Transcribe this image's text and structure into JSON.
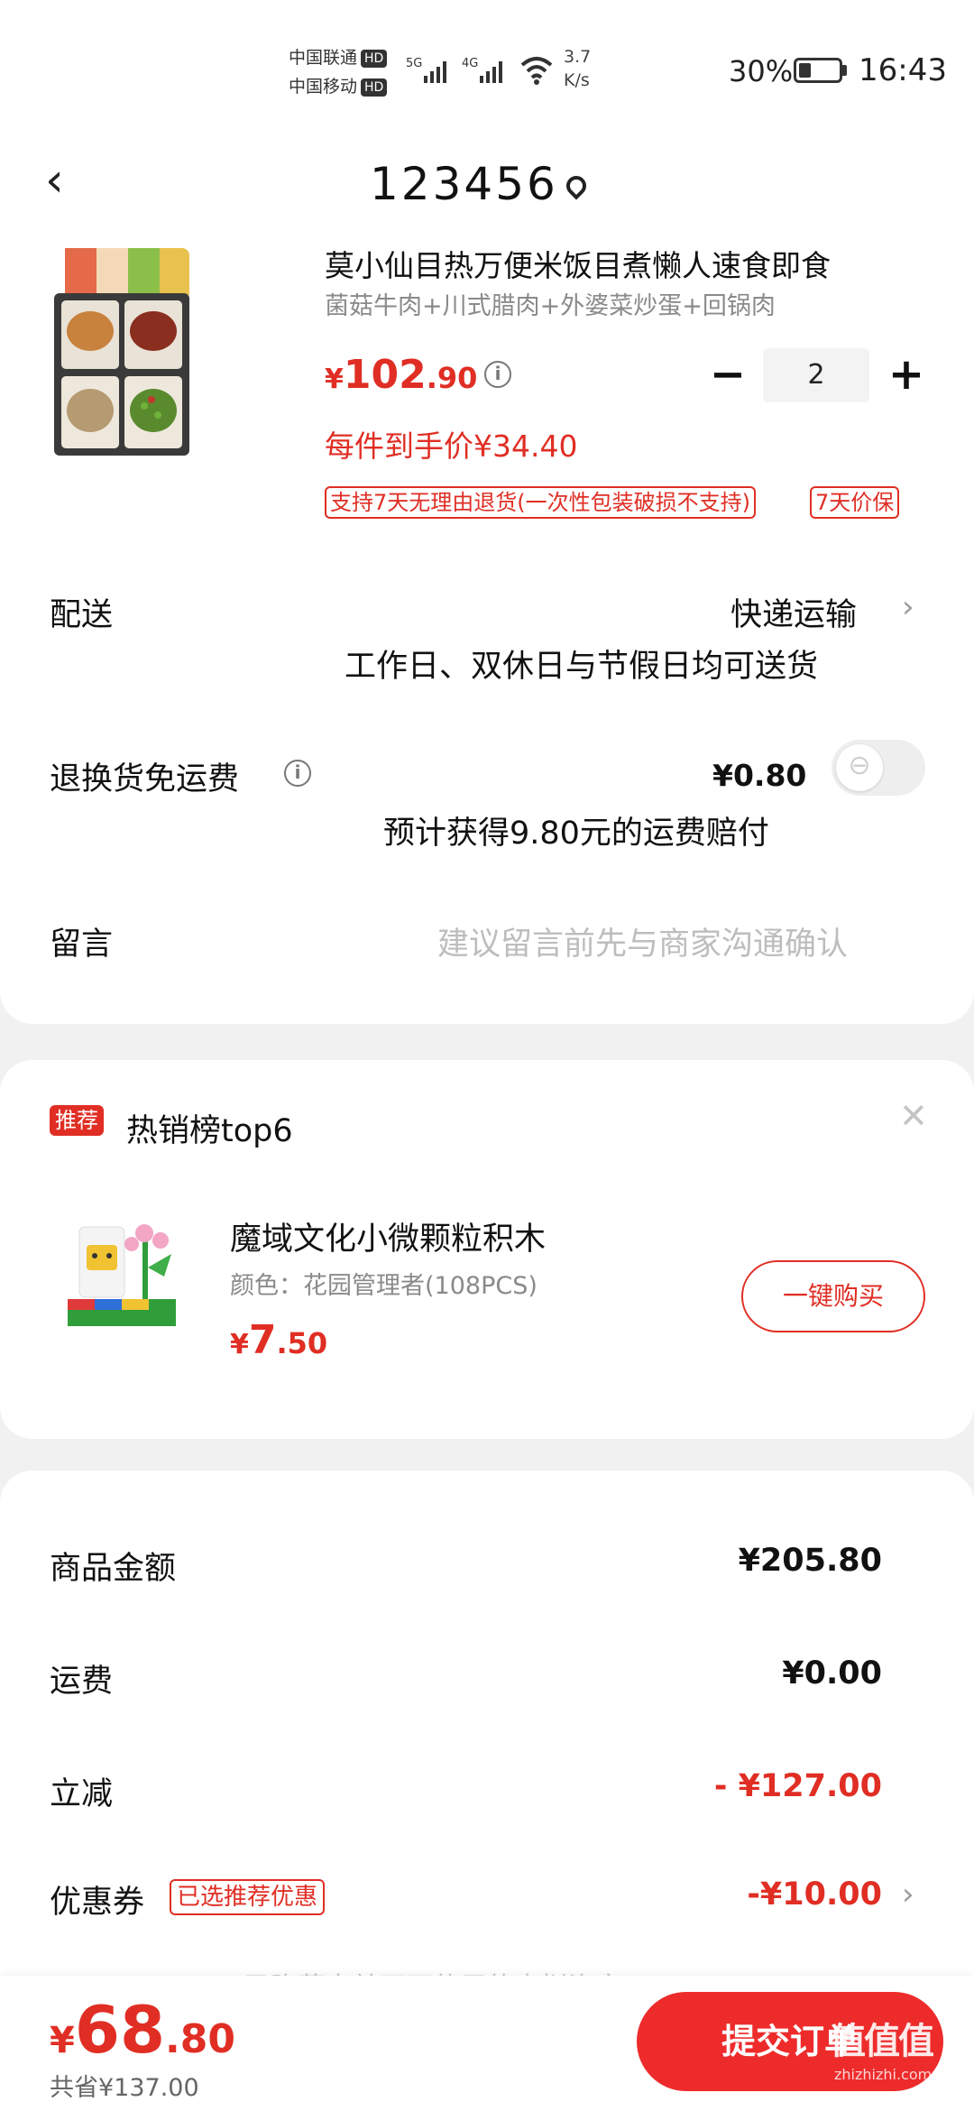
{
  "status_bar": {
    "carrier1": "中国联通",
    "carrier2": "中国移动",
    "hd": "HD",
    "sig1": "5G",
    "sig2": "4G",
    "speed_value": "3.7",
    "speed_unit": "K/s",
    "battery": "30%",
    "battery_level": 0.3,
    "time": "16:43"
  },
  "header": {
    "address": "123456"
  },
  "product": {
    "title": "莫小仙目热万便米饭目煮懒人速食即食",
    "spec": "菌菇牛肉+川式腊肉+外婆菜炒蛋+回锅肉",
    "price_symbol": "¥",
    "price_int": "102",
    "price_dec": ".90",
    "quantity": "2",
    "per_price": "每件到手价¥34.40",
    "tags": [
      "支持7天无理由退货(一次性包装破损不支持)",
      "7天价保"
    ]
  },
  "delivery": {
    "label": "配送",
    "method": "快递运输",
    "note": "工作日、双休日与节假日均可送货"
  },
  "return_insurance": {
    "label": "退换货免运费",
    "price": "¥0.80",
    "note": "预计获得9.80元的运费赔付"
  },
  "message": {
    "label": "留言",
    "placeholder": "建议留言前先与商家沟通确认"
  },
  "recommend": {
    "badge": "推荐",
    "title": "热销榜top6",
    "item_name": "魔域文化小微颗粒积木",
    "item_spec": "颜色：花园管理者(108PCS)",
    "price_symbol": "¥",
    "price_int": "7",
    "price_dec": ".50",
    "buy_label": "一键购买"
  },
  "summary": {
    "goods_label": "商品金额",
    "goods_value": "¥205.80",
    "shipping_label": "运费",
    "shipping_value": "¥0.00",
    "discount_label": "立减",
    "discount_value": "- ¥127.00",
    "coupon_label": "优惠券",
    "coupon_tag": "已选推荐优惠",
    "coupon_value": "-¥10.00",
    "hidden_note": "已隐藏本单不可使用的虚拟资产"
  },
  "bottom": {
    "total_symbol": "¥",
    "total_int": "68",
    "total_dec": ".80",
    "saved": "共省¥137.00",
    "submit": "提交订单",
    "watermark": "值值值",
    "watermark_sub": "zhizhizhi.com"
  },
  "colors": {
    "accent": "#e02e24",
    "submit": "#ee2b2b"
  }
}
